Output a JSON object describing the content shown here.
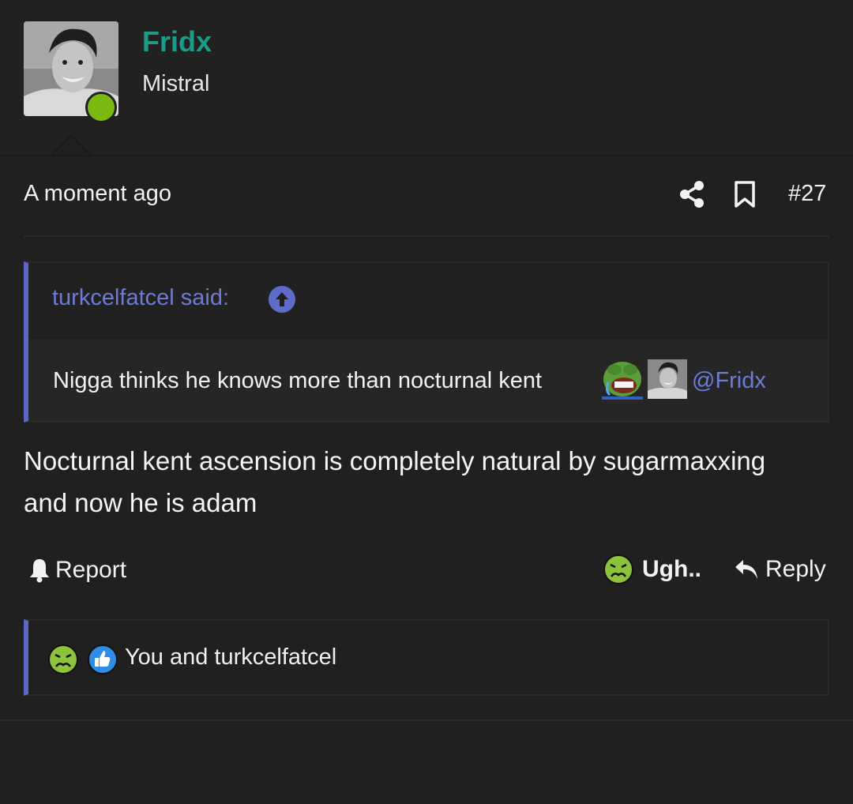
{
  "user": {
    "name": "Fridx",
    "title": "Mistral",
    "name_color": "#1d9b8a",
    "online_color": "#7cb911"
  },
  "post": {
    "timestamp": "A moment ago",
    "number": "#27",
    "body": "Nocturnal kent ascension is completely natural by sugarmaxxing and now he is adam"
  },
  "quote": {
    "header": "turkcelfatcel said:",
    "text": "Nigga thinks he knows more than nocturnal kent",
    "mention": "@Fridx",
    "accent_color": "#5a67c4"
  },
  "actions": {
    "report": "Report",
    "reaction": "Ugh..",
    "reply": "Reply"
  },
  "reactions": {
    "summary": "You and turkcelfatcel",
    "icons": [
      "sick-emoji-icon",
      "like-icon"
    ]
  }
}
